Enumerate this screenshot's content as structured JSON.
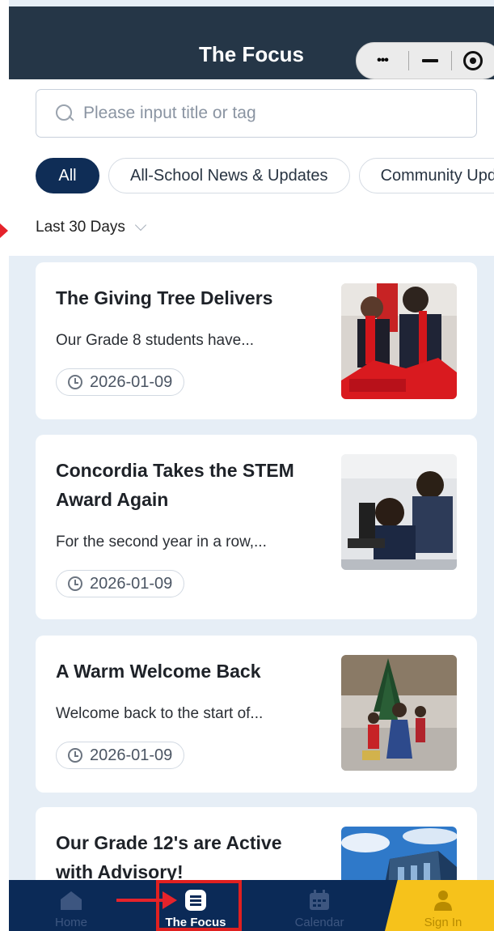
{
  "header": {
    "title": "The Focus"
  },
  "capsule": {
    "more": "•••",
    "minimize": "minimize",
    "close": "close"
  },
  "search": {
    "placeholder": "Please input title or tag",
    "value": ""
  },
  "tags": [
    {
      "label": "All",
      "active": true
    },
    {
      "label": "All-School News & Updates",
      "active": false
    },
    {
      "label": "Community Updates",
      "active": false
    }
  ],
  "filter": {
    "label": "Last 30 Days"
  },
  "articles": [
    {
      "title": "The Giving Tree Delivers",
      "summary": "Our Grade 8 students have...",
      "date": "2026-01-09",
      "image": "students-red-scarves"
    },
    {
      "title": "Concordia Takes the STEM Award Again",
      "summary": "For the second year in a row,...",
      "date": "2026-01-09",
      "image": "students-microscope"
    },
    {
      "title": "A Warm Welcome Back",
      "summary": "Welcome back to the start of...",
      "date": "2026-01-09",
      "image": "children-christmas-tree"
    },
    {
      "title": "Our Grade 12's are Active with Advisory!",
      "summary": "",
      "date": "",
      "image": "building-blue-sky"
    }
  ],
  "tabbar": {
    "items": [
      {
        "label": "Home",
        "icon": "home-icon",
        "active": false
      },
      {
        "label": "The Focus",
        "icon": "news-icon",
        "active": true
      },
      {
        "label": "Calendar",
        "icon": "calendar-icon",
        "active": false
      },
      {
        "label": "Sign In",
        "icon": "person-icon",
        "active": false
      }
    ]
  },
  "colors": {
    "header": "#253647",
    "accent": "#0f2d56",
    "tabbar": "#0b2a57",
    "signin": "#f6c21b",
    "annotation": "#e02020"
  }
}
